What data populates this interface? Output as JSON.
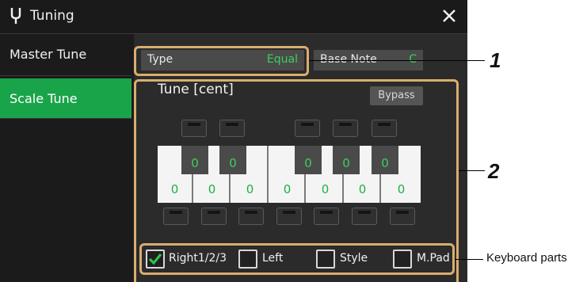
{
  "title_bar": {
    "title": "Tuning",
    "icon": "tuning-fork-icon",
    "close_icon": "close-icon"
  },
  "sidebar": {
    "items": [
      {
        "label": "Master Tune",
        "active": false
      },
      {
        "label": "Scale Tune",
        "active": true
      }
    ]
  },
  "type_field": {
    "label": "Type",
    "value": "Equal"
  },
  "base_note_field": {
    "label": "Base Note",
    "value": "C"
  },
  "tune": {
    "label": "Tune [cent]",
    "bypass_label": "Bypass",
    "black_key_values": [
      "0",
      "0",
      "0",
      "0",
      "0"
    ],
    "white_key_values": [
      "0",
      "0",
      "0",
      "0",
      "0",
      "0",
      "0"
    ]
  },
  "parts": [
    {
      "label": "Right1/2/3",
      "checked": true
    },
    {
      "label": "Left",
      "checked": false
    },
    {
      "label": "Style",
      "checked": false
    },
    {
      "label": "M.Pad",
      "checked": false
    }
  ],
  "callouts": {
    "one": "1",
    "two": "2",
    "keyboard_parts": "Keyboard parts"
  },
  "colors": {
    "accent_green": "#1aa44a",
    "value_green": "#3ccf5c",
    "frame": "#d9ad6f"
  }
}
